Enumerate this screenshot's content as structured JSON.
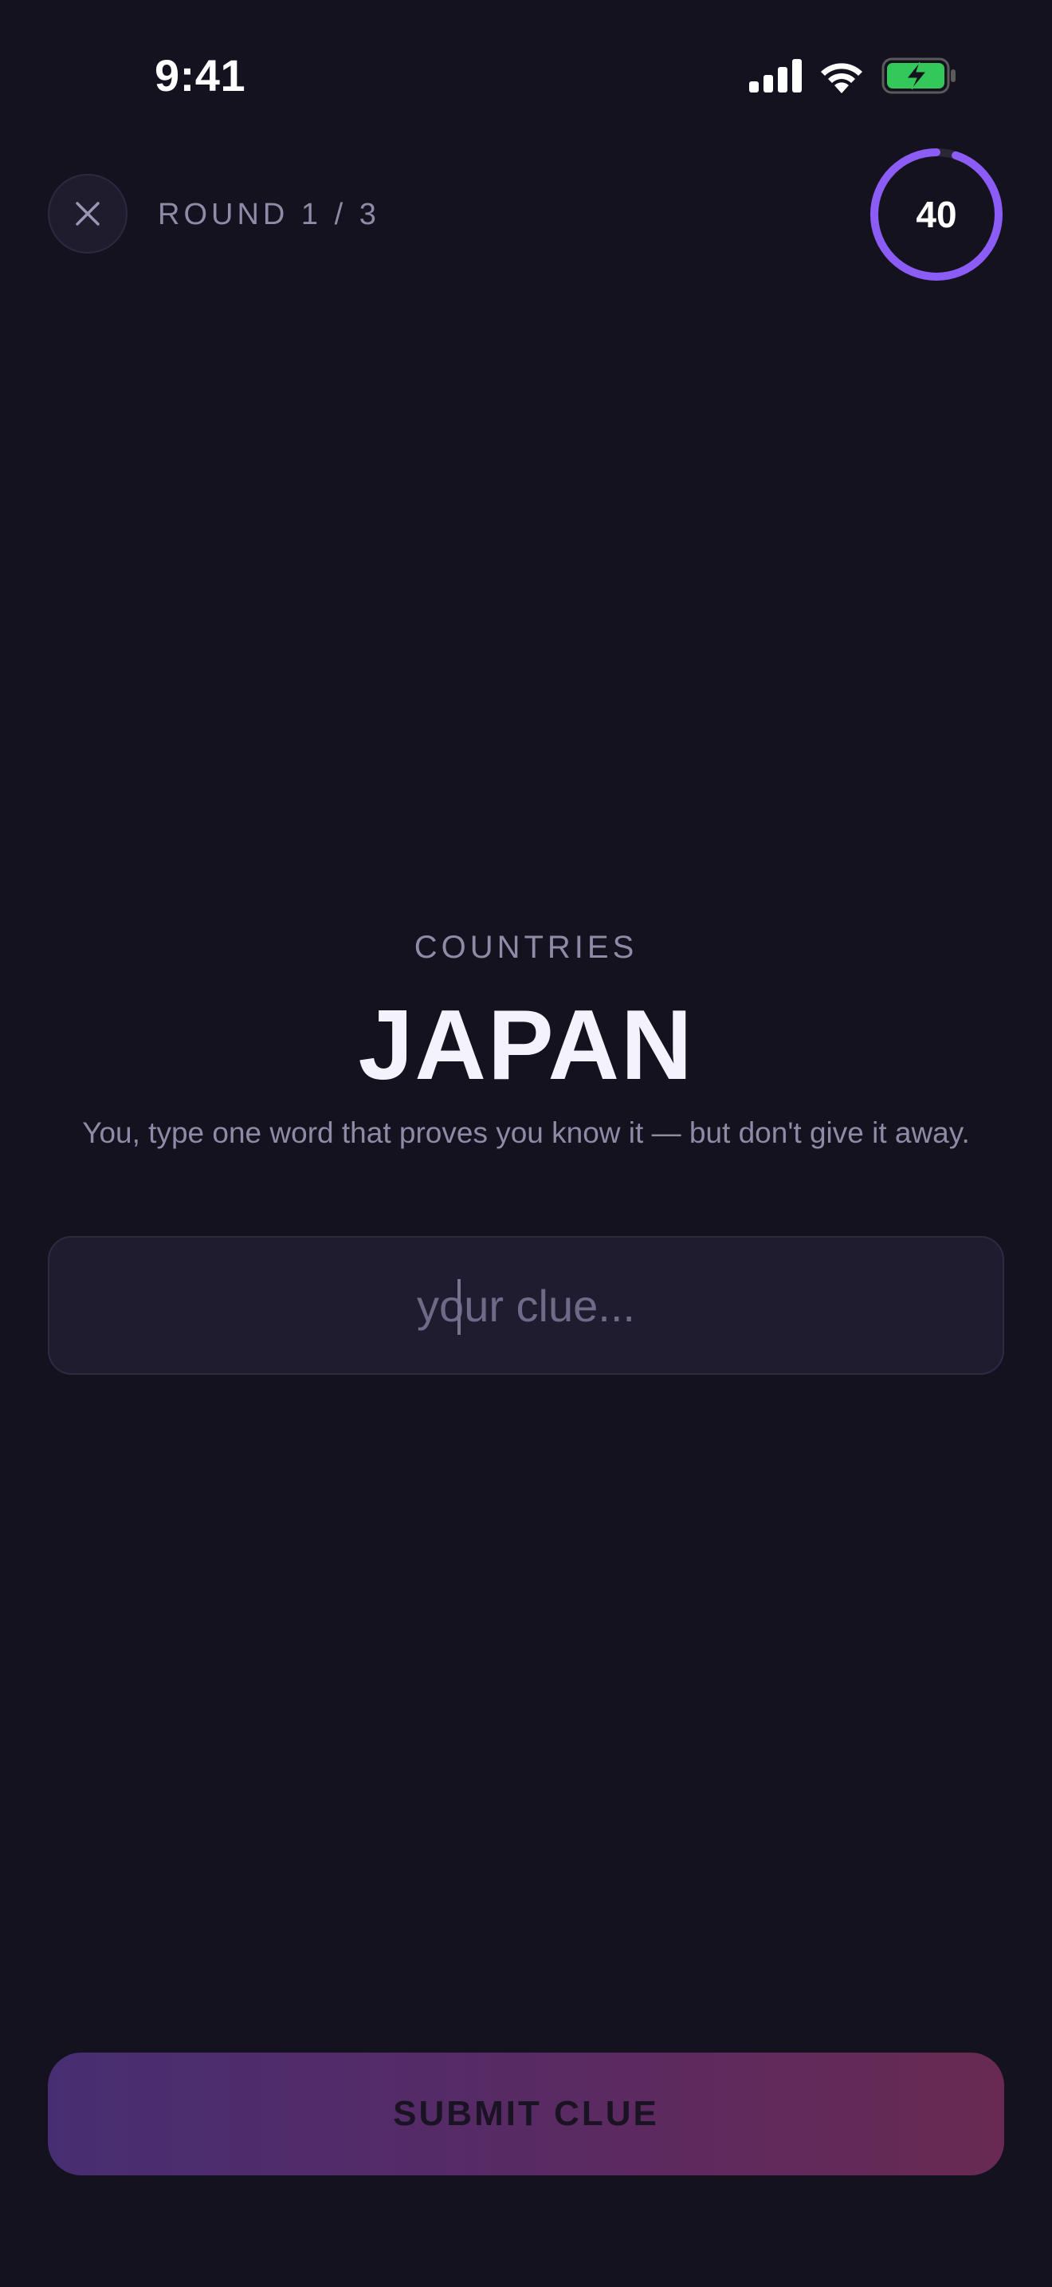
{
  "status_bar": {
    "time": "9:41"
  },
  "header": {
    "close_icon": "close-icon",
    "round_label": "ROUND 1 / 3",
    "timer": {
      "value": "40",
      "progress": 0.95,
      "ring_color": "#8b5cf6"
    }
  },
  "main": {
    "category": "COUNTRIES",
    "word": "JAPAN",
    "instruction": "You, type one word that proves you know it — but don't give it away.",
    "clue_input": {
      "value": "",
      "placeholder": "your clue..."
    }
  },
  "footer": {
    "submit_label": "SUBMIT CLUE"
  },
  "colors": {
    "background": "#14121f",
    "accent": "#8b5cf6",
    "battery": "#34c759"
  }
}
